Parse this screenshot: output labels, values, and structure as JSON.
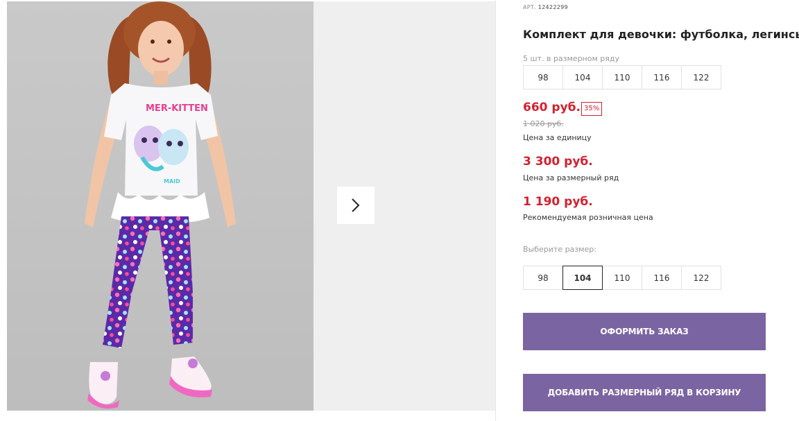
{
  "product": {
    "article_label": "АРТ.",
    "article_number": "12422299",
    "title": "Комплект для девочки: футболка, легинсы",
    "range_hint": "5 шт. в размерном ряду",
    "range_sizes": [
      "98",
      "104",
      "110",
      "116",
      "122"
    ]
  },
  "pricing": {
    "unit_price": "660 руб.",
    "discount_badge": "35%",
    "old_price": "1 020 руб.",
    "unit_price_label": "Цена за единицу",
    "range_price": "3 300 руб.",
    "range_price_label": "Цена за размерный ряд",
    "retail_price": "1 190 руб.",
    "retail_price_label": "Рекомендуемая розничная цена"
  },
  "size_select": {
    "label": "Выберите размер:",
    "options": [
      "98",
      "104",
      "110",
      "116",
      "122"
    ],
    "selected": "104"
  },
  "actions": {
    "order_button": "ОФОРМИТЬ ЗАКАЗ",
    "add_range_button": "ДОБАВИТЬ РАЗМЕРНЫЙ РЯД В КОРЗИНУ"
  },
  "gallery": {
    "next_icon": "chevron-right-icon",
    "print_text_top": "MER-KITTEN",
    "print_text_bottom": "MAID"
  },
  "colors": {
    "accent_red": "#d3202f",
    "button_purple": "#7b64a2"
  }
}
